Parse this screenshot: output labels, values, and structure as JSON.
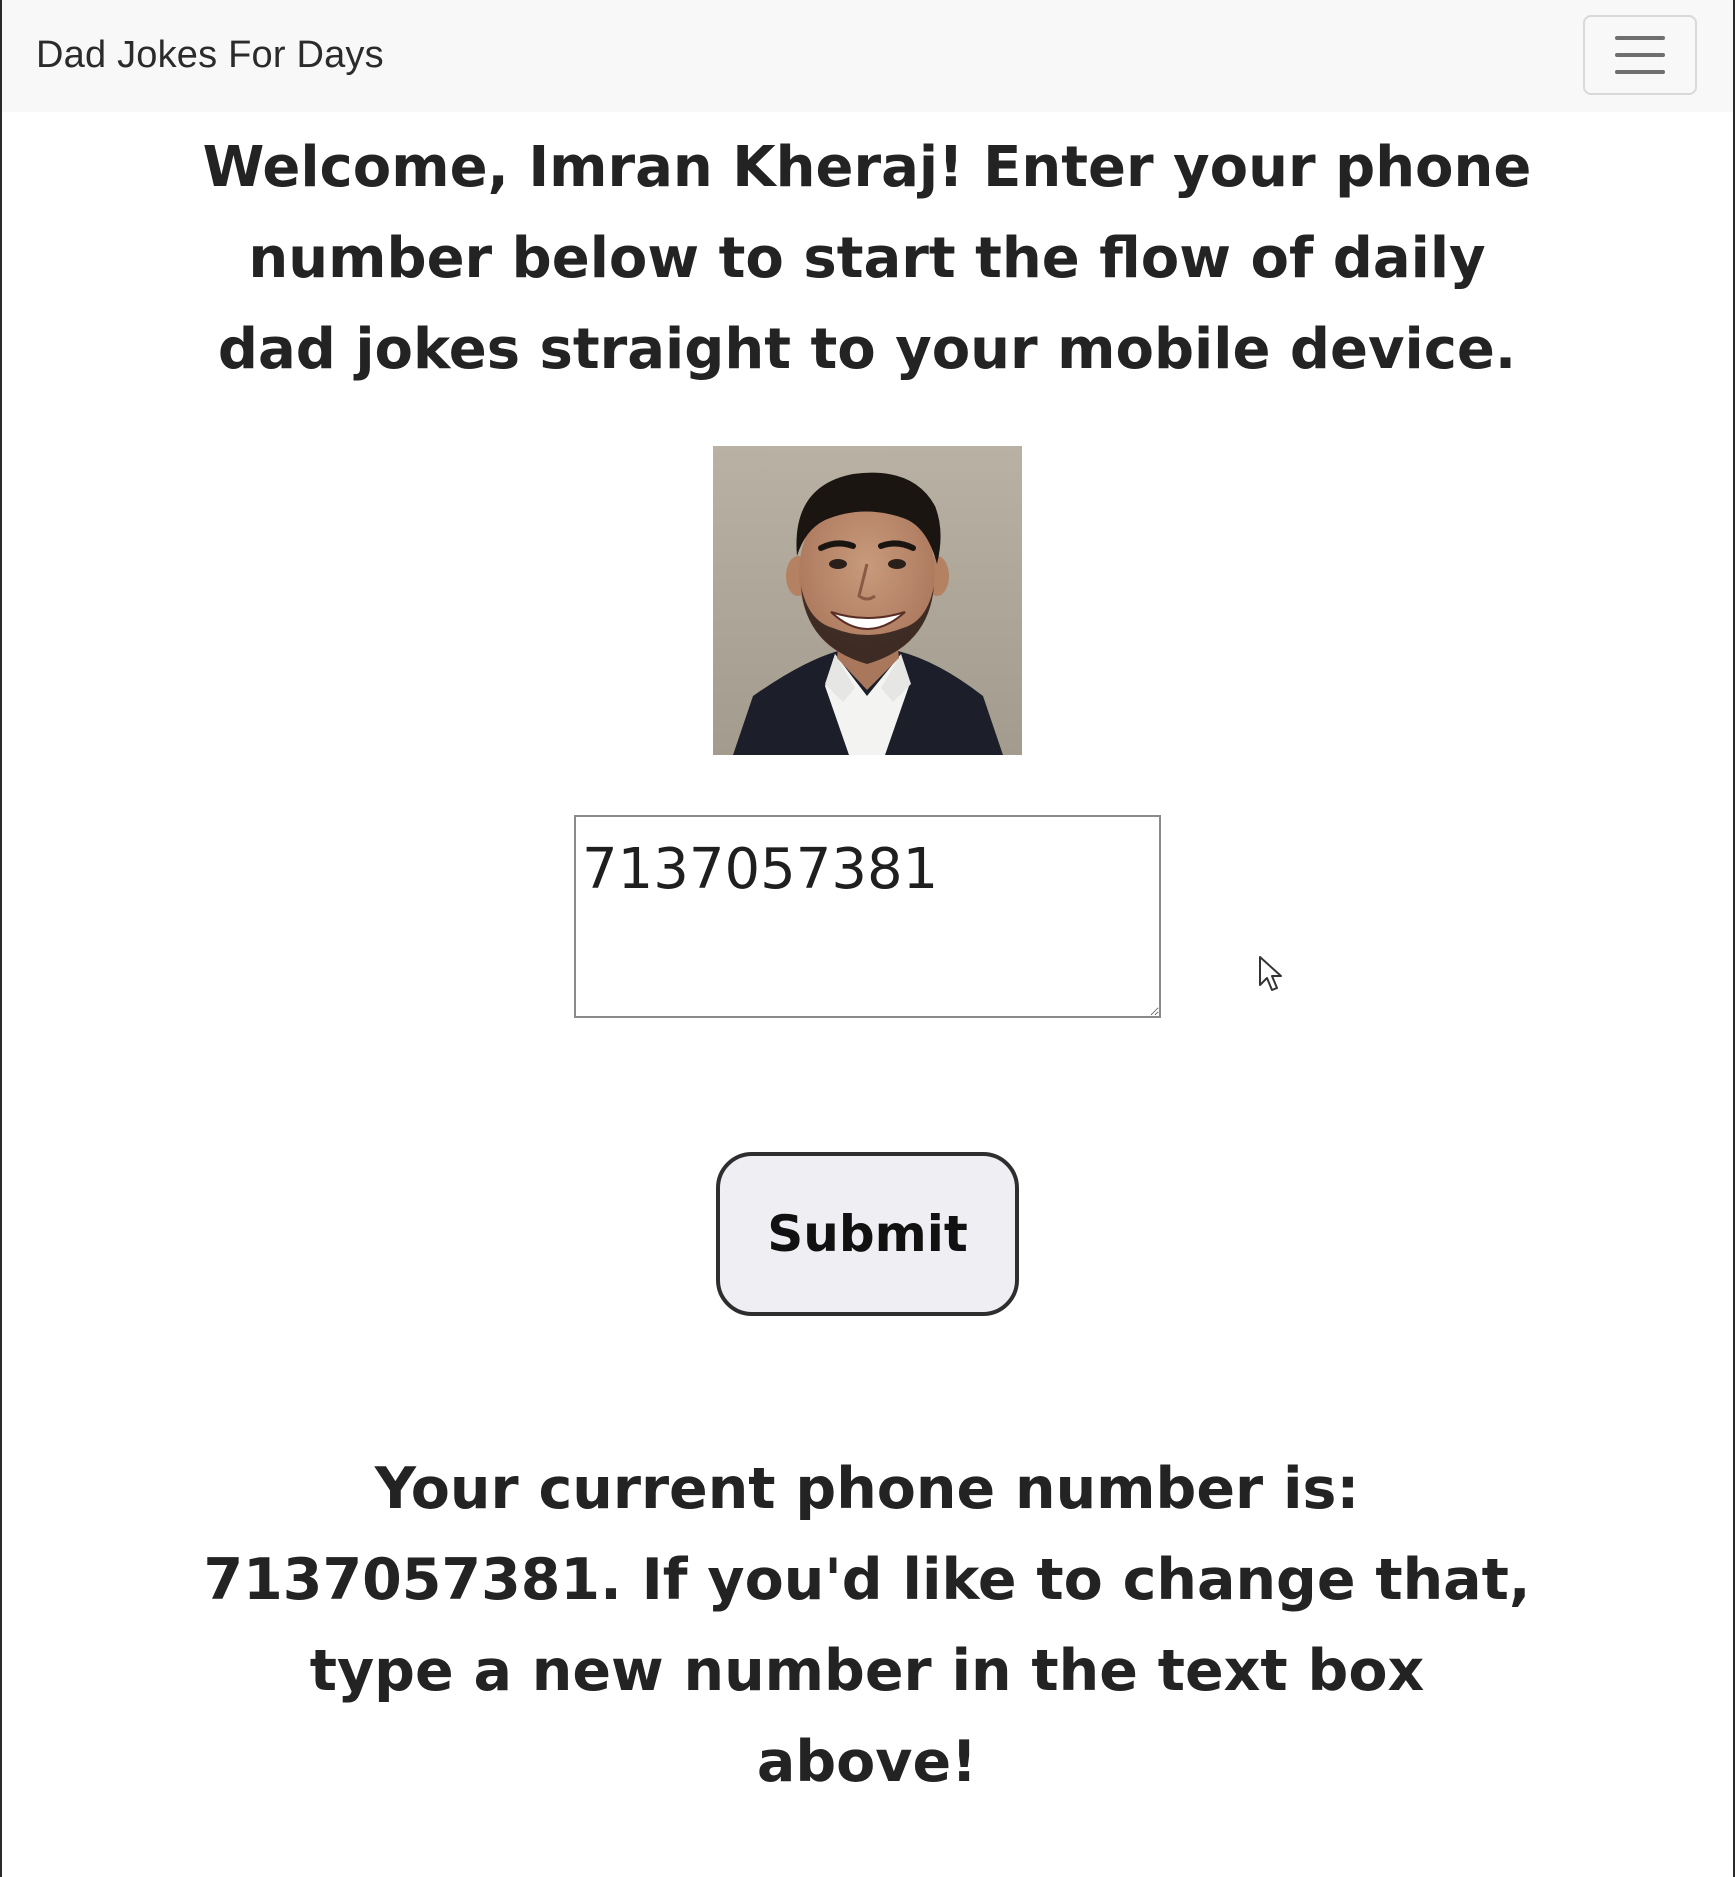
{
  "navbar": {
    "brand": "Dad Jokes For Days",
    "menu_icon": "hamburger-menu-icon"
  },
  "main": {
    "welcome_text": "Welcome, Imran Kheraj! Enter your phone number below to start the flow of daily dad jokes straight to your mobile device.",
    "avatar_icon": "profile-photo",
    "phone_value": "7137057381",
    "submit_label": "Submit",
    "current_text": "Your current phone number is: 7137057381. If you'd like to change that, type a new number in the text box above!"
  },
  "colors": {
    "navbar_bg": "#f8f8f8",
    "text": "#232323",
    "button_bg": "#efeef2",
    "button_border": "#2e2e2e"
  }
}
